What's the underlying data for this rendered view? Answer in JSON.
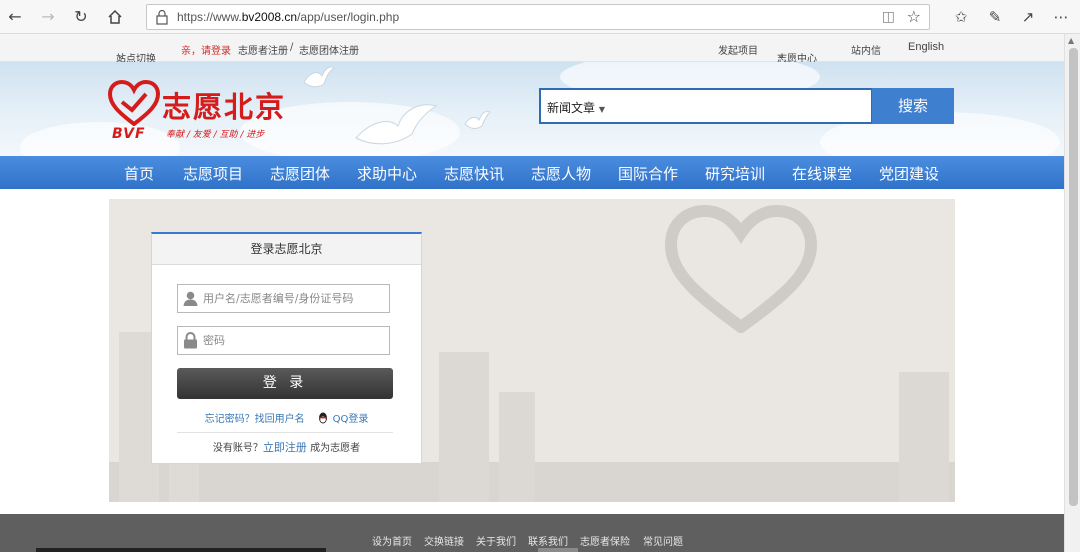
{
  "browser": {
    "url_prefix": "https://www.",
    "url_host": "bv2008.cn",
    "url_path": "/app/user/login.php",
    "icons": [
      "back-icon",
      "forward-icon",
      "refresh-icon",
      "home-icon",
      "lock-icon",
      "reader-icon",
      "favorite-star-icon",
      "favorites-icon",
      "pen-icon",
      "share-icon",
      "more-icon"
    ]
  },
  "topbar": {
    "site_switch": "站点切换",
    "greeting": "亲，请登录",
    "volunteer_register": "志愿者注册",
    "separator": "/",
    "group_register": "志愿团体注册",
    "launch_project": "发起项目",
    "volunteer_center": "志愿中心",
    "inbox": "站内信",
    "english": "English"
  },
  "header": {
    "logo_name": "志愿北京",
    "logo_bvf": "BVF",
    "slogan": "奉献 / 友爱 / 互助 / 进步",
    "search_category": "新闻文章",
    "search_button": "搜索"
  },
  "nav": {
    "items": [
      "首页",
      "志愿项目",
      "志愿团体",
      "求助中心",
      "志愿快讯",
      "志愿人物",
      "国际合作",
      "研究培训",
      "在线课堂",
      "党团建设"
    ]
  },
  "login": {
    "title": "登录志愿北京",
    "username_placeholder": "用户名/志愿者编号/身份证号码",
    "password_placeholder": "密码",
    "submit": "登 录",
    "forgot_password": "忘记密码？",
    "find_username": "找回用户名",
    "qq_login": "QQ登录",
    "no_account": "没有账号？",
    "register_now": "立即注册",
    "become_volunteer": "成为志愿者"
  },
  "footer": {
    "links": [
      "设为首页",
      "交换链接",
      "关于我们",
      "联系我们",
      "志愿者保险",
      "常见问题"
    ]
  },
  "colors": {
    "brand_red": "#d61b1b",
    "nav_blue": "#3a7acc",
    "search_blue": "#3f7fd0"
  }
}
